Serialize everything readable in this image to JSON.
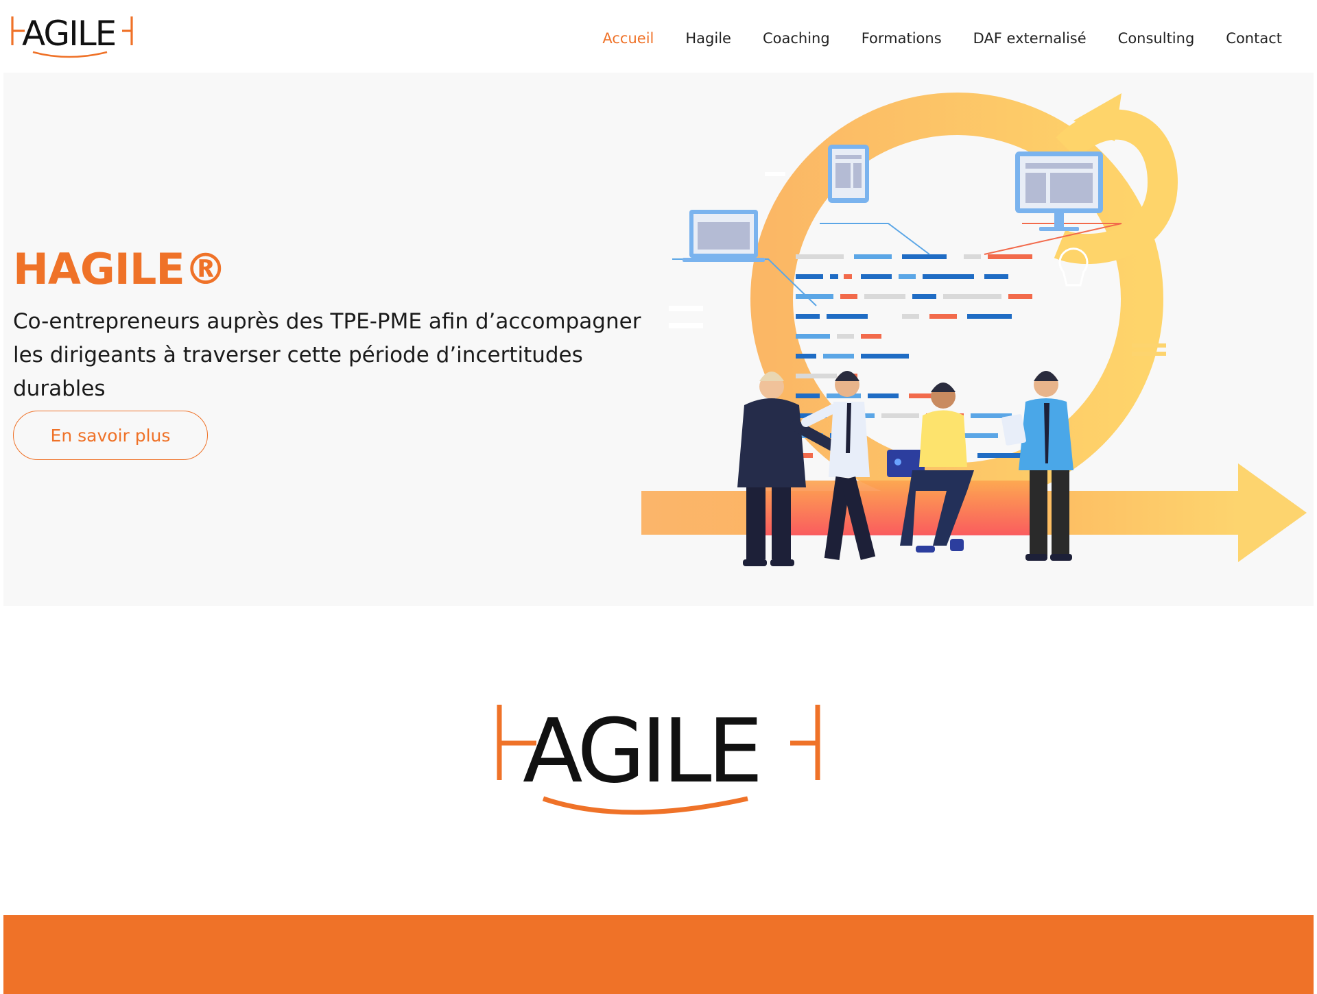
{
  "brand": {
    "logo_text": "HAGILE",
    "accent_color": "#ef7228",
    "band_color": "#ef7228"
  },
  "nav": {
    "items": [
      {
        "label": "Accueil",
        "active": true
      },
      {
        "label": "Hagile",
        "active": false
      },
      {
        "label": "Coaching",
        "active": false
      },
      {
        "label": "Formations",
        "active": false
      },
      {
        "label": "DAF externalisé",
        "active": false
      },
      {
        "label": "Consulting",
        "active": false
      },
      {
        "label": "Contact",
        "active": false
      }
    ]
  },
  "hero": {
    "title": "HAGILE®",
    "description": "Co-entrepreneurs auprès des TPE-PME afin d’accompagner les dirigeants à traverser cette période d’incertitudes durables",
    "cta_label": "En savoir plus",
    "illustration": "agile-team-cycle-illustration"
  }
}
